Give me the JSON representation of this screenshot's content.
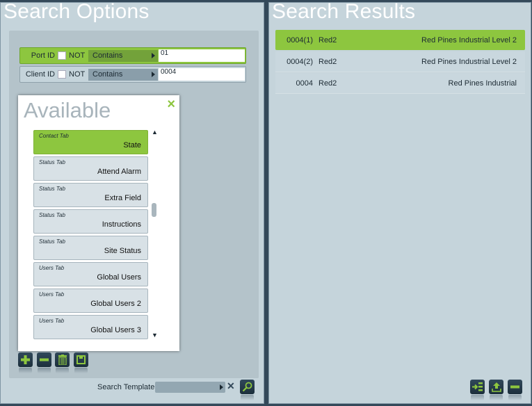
{
  "search_options": {
    "title": "Search Options",
    "criteria": [
      {
        "label": "Port ID",
        "not_label": "NOT",
        "not_checked": false,
        "operator": "Contains",
        "value": "01",
        "active": true
      },
      {
        "label": "Client ID",
        "not_label": "NOT",
        "not_checked": false,
        "operator": "Contains",
        "value": "0004",
        "active": false
      }
    ],
    "available": {
      "title": "Available",
      "close_icon": "×",
      "items": [
        {
          "category": "Contact Tab",
          "name": "State",
          "selected": true
        },
        {
          "category": "Status Tab",
          "name": "Attend Alarm",
          "selected": false
        },
        {
          "category": "Status Tab",
          "name": "Extra Field",
          "selected": false
        },
        {
          "category": "Status Tab",
          "name": "Instructions",
          "selected": false
        },
        {
          "category": "Status Tab",
          "name": "Site Status",
          "selected": false
        },
        {
          "category": "Users Tab",
          "name": "Global Users",
          "selected": false
        },
        {
          "category": "Users Tab",
          "name": "Global Users 2",
          "selected": false
        },
        {
          "category": "Users Tab",
          "name": "Global Users 3",
          "selected": false
        }
      ],
      "scroll_up": "▲",
      "scroll_down": "▼"
    },
    "toolbar": [
      "add-icon",
      "remove-icon",
      "delete-icon",
      "save-icon"
    ],
    "template_label": "Search Template",
    "template_value": "",
    "clear_icon": "✕"
  },
  "search_results": {
    "title": "Search Results",
    "rows": [
      {
        "id": "0004(1)",
        "name": "Red2",
        "description": "Red Pines Industrial Level 2",
        "selected": true
      },
      {
        "id": "0004(2)",
        "name": "Red2",
        "description": "Red Pines Industrial Level 2",
        "selected": false
      },
      {
        "id": "0004",
        "name": "Red2",
        "description": "Red Pines Industrial",
        "selected": false
      }
    ],
    "toolbar": [
      "assign-icon",
      "upload-icon",
      "remove-icon"
    ]
  },
  "colors": {
    "accent": "#8dc63f",
    "panel": "#c5d4db",
    "background": "#34495a"
  }
}
